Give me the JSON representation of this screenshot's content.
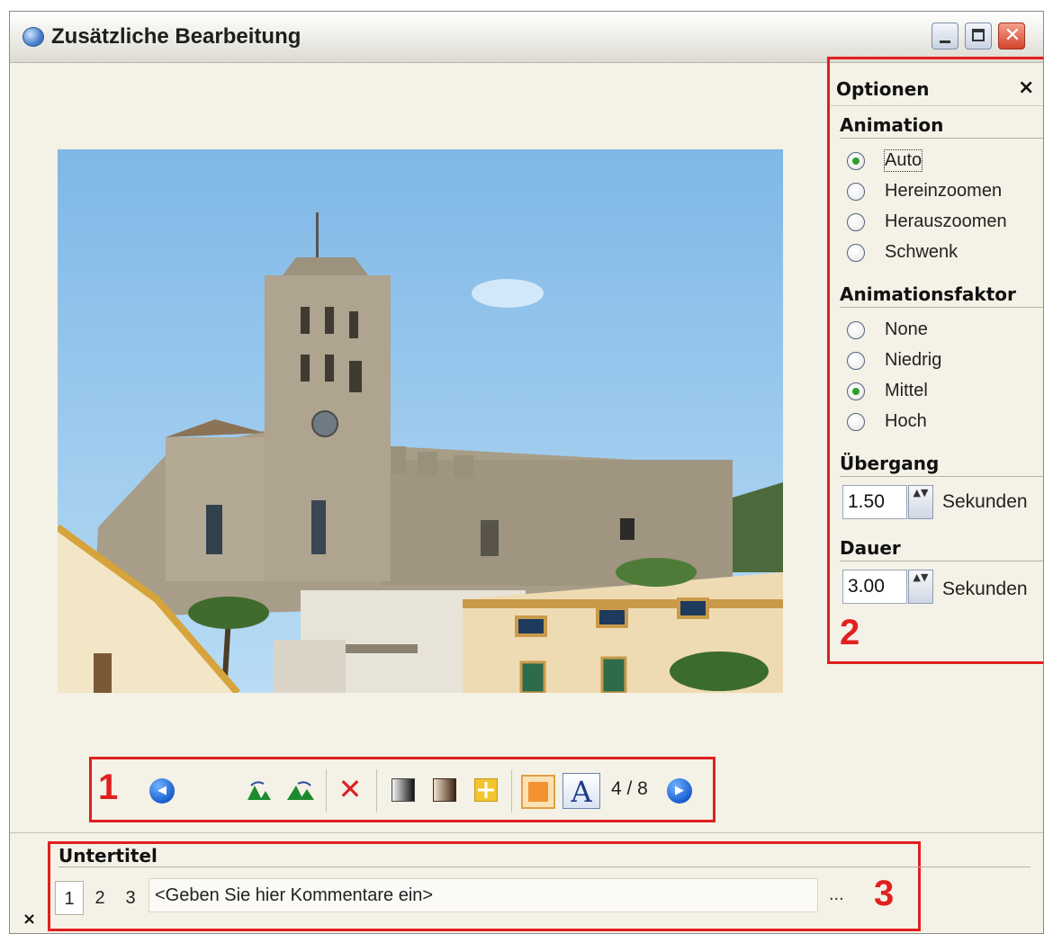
{
  "window": {
    "title": "Zusätzliche Bearbeitung",
    "icon": "app-icon",
    "close_glyph": "✕"
  },
  "toolbar": {
    "callout": "1",
    "prev_icon": "◀",
    "next_icon": "▶",
    "delete_glyph": "✕",
    "font_glyph": "A",
    "page_counter": "4 / 8"
  },
  "options": {
    "callout": "2",
    "title": "Optionen",
    "close_glyph": "×",
    "animation": {
      "title": "Animation",
      "items": [
        {
          "label": "Auto",
          "checked": true
        },
        {
          "label": "Hereinzoomen",
          "checked": false
        },
        {
          "label": "Herauszoomen",
          "checked": false
        },
        {
          "label": "Schwenk",
          "checked": false
        }
      ]
    },
    "factor": {
      "title": "Animationsfaktor",
      "items": [
        {
          "label": "None",
          "checked": false
        },
        {
          "label": "Niedrig",
          "checked": false
        },
        {
          "label": "Mittel",
          "checked": true
        },
        {
          "label": "Hoch",
          "checked": false
        }
      ]
    },
    "transition": {
      "title": "Übergang",
      "value": "1.50",
      "unit": "Sekunden"
    },
    "duration": {
      "title": "Dauer",
      "value": "3.00",
      "unit": "Sekunden"
    },
    "spin_glyph": "▲▼"
  },
  "subtitles": {
    "callout": "3",
    "title": "Untertitel",
    "close_glyph": "×",
    "numbers": [
      "1",
      "2",
      "3"
    ],
    "active": "1",
    "comment_value": "<Geben Sie hier Kommentare ein>",
    "more": "..."
  },
  "colors": {
    "callout": "#e01f1f",
    "radio_checked": "#2ca02c"
  }
}
